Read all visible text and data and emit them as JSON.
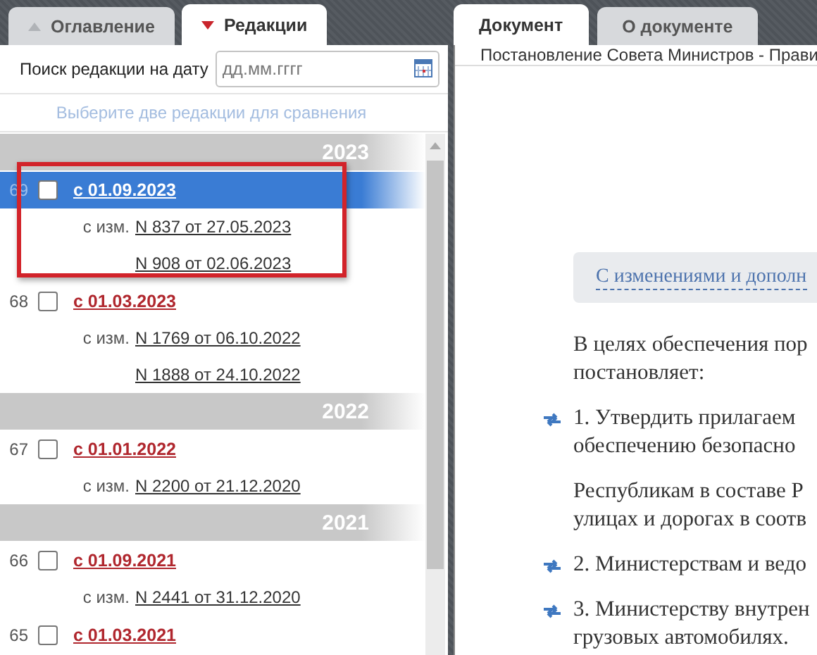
{
  "left_tabs": [
    {
      "label": "Оглавление",
      "selected": false
    },
    {
      "label": "Редакции",
      "selected": true
    }
  ],
  "date_search": {
    "label": "Поиск редакции на дату",
    "placeholder": "дд.мм.гггг"
  },
  "compare_hint": "Выберите две редакции для сравнения",
  "editions": [
    {
      "year": "2023",
      "items": [
        {
          "number": "69",
          "date": "с 01.09.2023",
          "selected": true,
          "checked": false,
          "highlighted": true,
          "changes_label": "с изм.",
          "changes": [
            "N 837 от 27.05.2023",
            "N 908 от 02.06.2023"
          ]
        },
        {
          "number": "68",
          "date": "с 01.03.2023",
          "selected": false,
          "checked": false,
          "highlighted": false,
          "changes_label": "с изм.",
          "changes": [
            "N 1769 от 06.10.2022",
            "N 1888 от 24.10.2022"
          ]
        }
      ]
    },
    {
      "year": "2022",
      "items": [
        {
          "number": "67",
          "date": "с 01.01.2022",
          "selected": false,
          "checked": false,
          "highlighted": false,
          "changes_label": "с изм.",
          "changes": [
            "N 2200 от 21.12.2020"
          ]
        }
      ]
    },
    {
      "year": "2021",
      "items": [
        {
          "number": "66",
          "date": "с 01.09.2021",
          "selected": false,
          "checked": false,
          "highlighted": false,
          "changes_label": "с изм.",
          "changes": [
            "N 2441 от 31.12.2020"
          ]
        },
        {
          "number": "65",
          "date": "с 01.03.2021",
          "selected": false,
          "checked": false,
          "highlighted": false
        }
      ]
    }
  ],
  "right_tabs": [
    {
      "label": "Документ",
      "selected": true
    },
    {
      "label": "О документе",
      "selected": false
    }
  ],
  "doc_title": "Постановление Совета Министров - Прави",
  "doc_banner": "С изменениями и дополн",
  "paragraphs": [
    {
      "kind": "plain",
      "lines": [
        "В целях обеспечения пор",
        "постановляет:"
      ]
    },
    {
      "kind": "linked",
      "lines": [
        "1. Утвердить прилагаем",
        "обеспечению безопасно"
      ]
    },
    {
      "kind": "plain",
      "lines": [
        "Республикам в составе Р",
        "улицах и дорогах в соотв"
      ]
    },
    {
      "kind": "linked",
      "lines": [
        "2. Министерствам и ведо"
      ]
    },
    {
      "kind": "linked",
      "lines": [
        "3. Министерству внутрен",
        "грузовых автомобилях."
      ]
    }
  ]
}
